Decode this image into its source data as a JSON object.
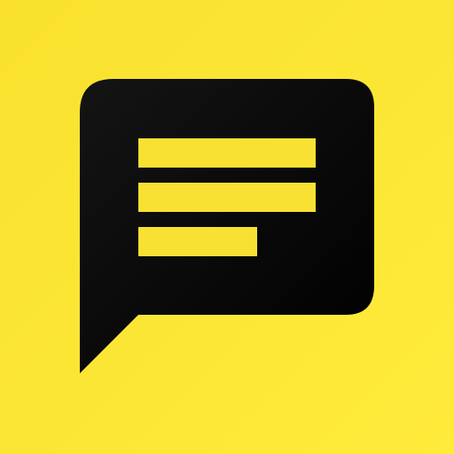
{
  "icon": {
    "name": "message-bubble-icon",
    "colors": {
      "background_top": "#F9E12E",
      "background_bottom": "#FFEB3B",
      "bubble_top": "#141414",
      "bubble_bottom": "#000000",
      "lines": "#F9E133"
    }
  }
}
